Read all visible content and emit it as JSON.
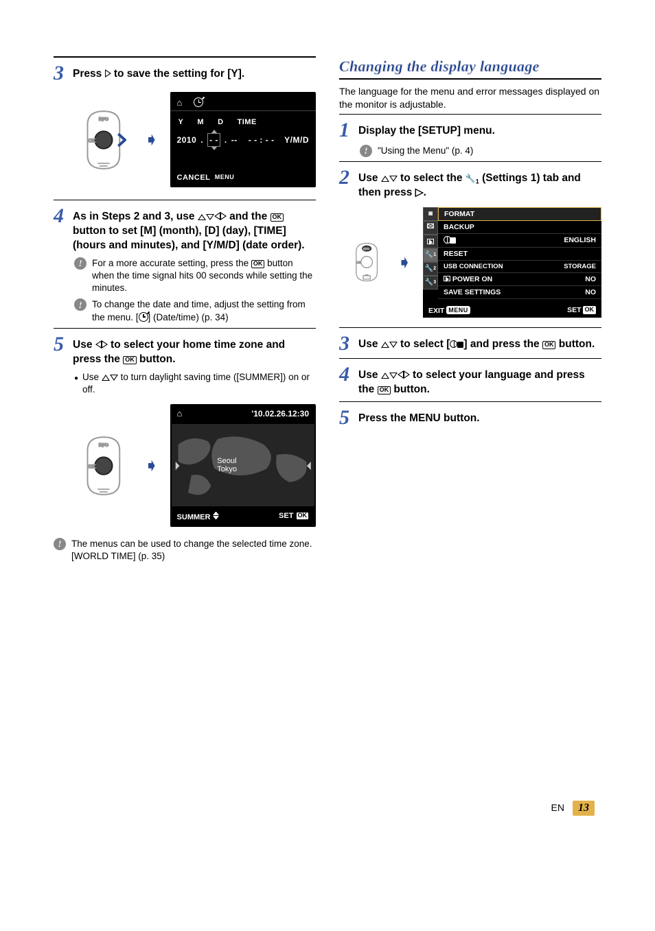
{
  "left": {
    "step3": {
      "text": "Press ▷ to save the setting for [Y]."
    },
    "datepanel": {
      "headers": [
        "Y",
        "M",
        "D",
        "TIME"
      ],
      "year": "2010",
      "sep": ".",
      "m": "- -",
      "dash": "--",
      "time": "- - : - -",
      "order": "Y/M/D",
      "cancel": "CANCEL",
      "menu": "MENU"
    },
    "step4": {
      "text": "As in Steps 2 and 3, use △▽◁▷ and the OK button to set [M] (month), [D] (day), [TIME] (hours and minutes), and [Y/M/D] (date order).",
      "note1_a": "For a more accurate setting, press the ",
      "note1_b": " button when the time signal hits 00 seconds while setting the minutes.",
      "note2_a": "To change the date and time, adjust the setting from the menu. [",
      "note2_b": "] (Date/time) (p. 34)"
    },
    "step5": {
      "text": "Use ◁▷ to select your home time zone and press the OK button.",
      "bullet_a": "Use ",
      "bullet_b": " to turn daylight saving time ([SUMMER]) on or off."
    },
    "tz": {
      "top": "'10.02.26.12:30",
      "city1": "Seoul",
      "city2": "Tokyo",
      "summer": "SUMMER",
      "set": "SET"
    },
    "finalnote": "The menus can be used to change the selected time zone. [WORLD TIME] (p. 35)"
  },
  "right": {
    "title": "Changing the display language",
    "intro": "The language for the menu and error messages displayed on the monitor is adjustable.",
    "step1": {
      "text": "Display the [SETUP] menu.",
      "note": "\"Using the Menu\" (p. 4)"
    },
    "step2": {
      "text_a": "Use ",
      "text_b": " to select the ",
      "text_c": " (Settings 1) tab and then press ▷."
    },
    "setup": {
      "rows": [
        {
          "l": "FORMAT",
          "r": ""
        },
        {
          "l": "BACKUP",
          "r": ""
        },
        {
          "l": "LANG",
          "r": "ENGLISH"
        },
        {
          "l": "RESET",
          "r": ""
        },
        {
          "l": "USB CONNECTION",
          "r": "STORAGE"
        },
        {
          "l": "POWER ON",
          "r": "NO"
        },
        {
          "l": "SAVE SETTINGS",
          "r": "NO"
        }
      ],
      "exit": "EXIT",
      "menu": "MENU",
      "set": "SET",
      "ok": "OK"
    },
    "step3": {
      "text_a": "Use ",
      "text_b": " to select [",
      "text_c": "] and press the ",
      "text_d": " button."
    },
    "step4": {
      "text_a": "Use ",
      "text_b": " to select your language and press the ",
      "text_c": " button."
    },
    "step5": {
      "text_a": "Press the ",
      "text_b": " button."
    }
  },
  "footer": {
    "lang": "EN",
    "page": "13"
  }
}
